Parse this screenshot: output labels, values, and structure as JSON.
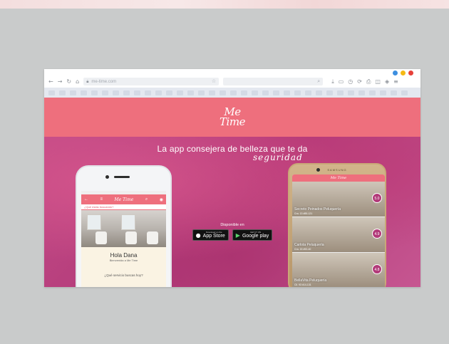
{
  "browser": {
    "url": "me-time.com",
    "window_dots": [
      "#3d8fe0",
      "#f5b915",
      "#e6413a"
    ],
    "toolbar_icons": [
      "back-icon",
      "forward-icon",
      "reload-icon",
      "home-icon"
    ],
    "right_icons": [
      "download-icon",
      "bookmark-icon",
      "history-icon",
      "sync-icon",
      "share-icon",
      "extension-icon",
      "shield-icon",
      "menu-icon"
    ]
  },
  "site": {
    "logo_line1": "Me",
    "logo_line2": "Time",
    "tagline": "La app consejera de belleza que te da",
    "tagline_accent": "seguridad",
    "store_label": "Disponible en",
    "appstore_small": "Download on the",
    "appstore_big": "App Store",
    "googleplay_small": "GET IT ON",
    "googleplay_big": "Google play"
  },
  "phone_iphone": {
    "logo": "Me Time",
    "search_placeholder": "¿Qué estás buscando?",
    "greeting": "Hola Dana",
    "subtitle": "Bienvenida a Me Time",
    "question": "¿Qué servicio buscas hoy?"
  },
  "phone_samsung": {
    "brand": "SAMSUNG",
    "logo": "Me Time",
    "items": [
      {
        "name": "Secreto Peinados Peluquería",
        "address": "Cra. 13 #85-121",
        "score": "5.0"
      },
      {
        "name": "Carlota Peluquería",
        "address": "Cra. 15 #92-40",
        "score": "4.9"
      },
      {
        "name": "BellaVita Peluquería",
        "address": "Cll. 93 #14-131",
        "score": "4.8"
      }
    ]
  }
}
